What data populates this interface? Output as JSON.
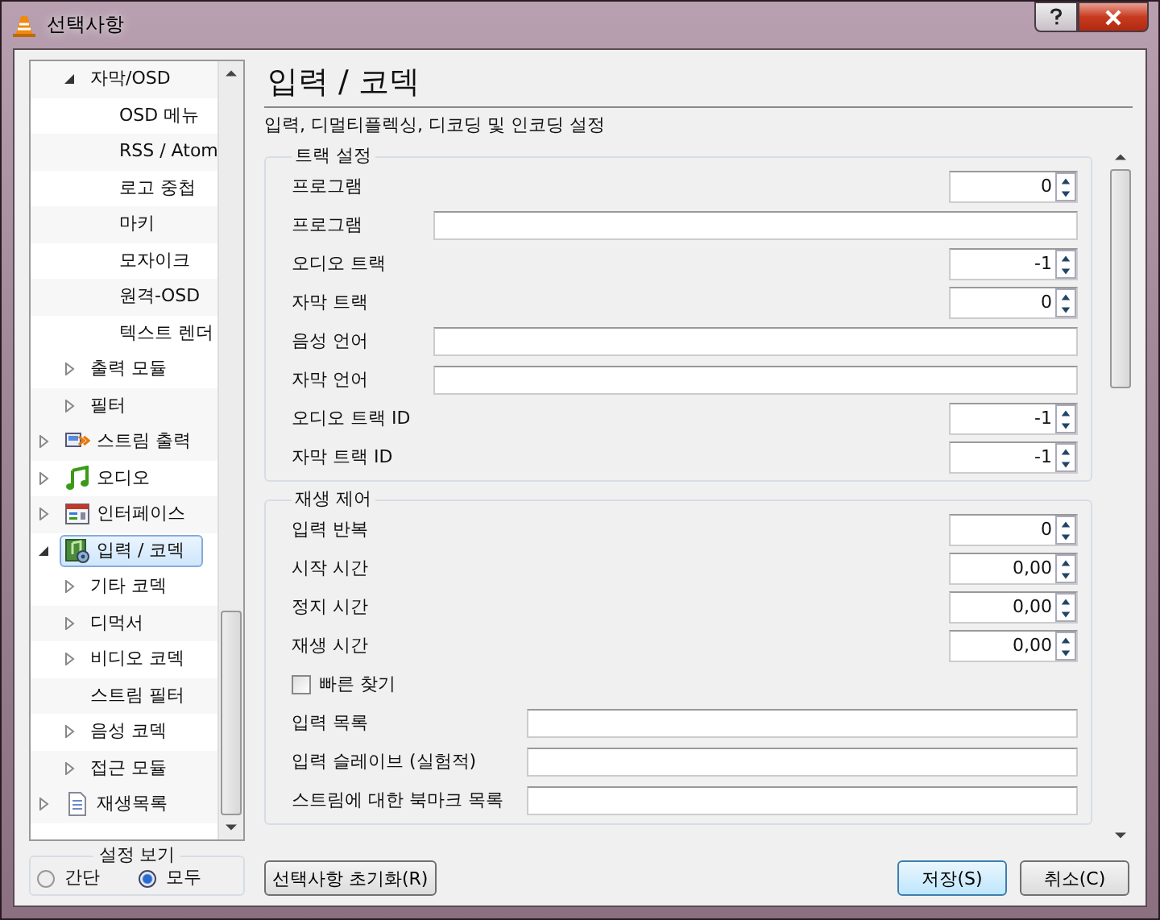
{
  "window": {
    "title": "선택사항"
  },
  "tree": {
    "continued_items": [
      {
        "label": "자막/OSD",
        "expanded": true,
        "selected": false,
        "children": [
          {
            "label": "OSD 메뉴",
            "selected": false
          },
          {
            "label": "RSS / Atom",
            "selected": false
          },
          {
            "label": "로고 중첩",
            "selected": false
          },
          {
            "label": "마키",
            "selected": false
          },
          {
            "label": "모자이크",
            "selected": false
          },
          {
            "label": "원격-OSD",
            "selected": false
          },
          {
            "label": "텍스트 렌더",
            "selected": false
          }
        ]
      },
      {
        "label": "출력 모듈",
        "expanded": false,
        "selected": false
      },
      {
        "label": "필터",
        "expanded": false,
        "selected": false
      }
    ],
    "items": [
      {
        "label": "스트림 출력",
        "kind": "stream",
        "expanded": false,
        "selected": false
      },
      {
        "label": "오디오",
        "kind": "audio",
        "expanded": false,
        "selected": false
      },
      {
        "label": "인터페이스",
        "kind": "interface",
        "expanded": false,
        "selected": false
      },
      {
        "label": "입력 / 코덱",
        "kind": "codec",
        "expanded": true,
        "selected": true,
        "children": [
          {
            "label": "기타 코덱",
            "expanded": false,
            "selected": false
          },
          {
            "label": "디먹서",
            "expanded": false,
            "selected": false
          },
          {
            "label": "비디오 코덱",
            "expanded": false,
            "selected": false
          },
          {
            "label": "스트림 필터",
            "selected": false
          },
          {
            "label": "음성 코덱",
            "expanded": false,
            "selected": false
          },
          {
            "label": "접근 모듈",
            "expanded": false,
            "selected": false
          }
        ]
      },
      {
        "label": "재생목록",
        "kind": "playlist",
        "expanded": false,
        "selected": false
      }
    ]
  },
  "view_mode": {
    "label": "설정 보기",
    "options": [
      {
        "label": "간단",
        "selected": false
      },
      {
        "label": "모두",
        "selected": true
      }
    ]
  },
  "panel": {
    "title": "입력 / 코덱",
    "description": "입력, 디멀티플렉싱, 디코딩 및 인코딩 설정",
    "groups": [
      {
        "title": "트랙 설정",
        "rows": [
          {
            "kind": "spin",
            "label": "프로그램",
            "value": "0"
          },
          {
            "kind": "text",
            "label": "프로그램"
          },
          {
            "kind": "spin",
            "label": "오디오 트랙",
            "value": "-1"
          },
          {
            "kind": "spin",
            "label": "자막 트랙",
            "value": "0"
          },
          {
            "kind": "text",
            "label": "음성 언어"
          },
          {
            "kind": "text",
            "label": "자막 언어"
          },
          {
            "kind": "spin",
            "label": "오디오 트랙 ID",
            "value": "-1"
          },
          {
            "kind": "spin",
            "label": "자막 트랙 ID",
            "value": "-1"
          }
        ]
      },
      {
        "title": "재생 제어",
        "rows": [
          {
            "kind": "spin",
            "label": "입력 반복",
            "value": "0"
          },
          {
            "kind": "spin",
            "label": "시작 시간",
            "value": "0,00"
          },
          {
            "kind": "spin",
            "label": "정지 시간",
            "value": "0,00"
          },
          {
            "kind": "spin",
            "label": "재생 시간",
            "value": "0,00"
          },
          {
            "kind": "checkbox",
            "label": "빠른 찾기",
            "checked": false
          },
          {
            "kind": "text",
            "label": "입력 목록"
          },
          {
            "kind": "text",
            "label": "입력 슬레이브 (실험적)"
          },
          {
            "kind": "text",
            "label": "스트림에 대한 북마크 목록"
          }
        ]
      }
    ]
  },
  "buttons": [
    {
      "label": "선택사항 초기화(R)",
      "kind": "reset"
    },
    {
      "label": "저장(S)",
      "kind": "default"
    },
    {
      "label": "취소(C)",
      "kind": "normal"
    }
  ]
}
